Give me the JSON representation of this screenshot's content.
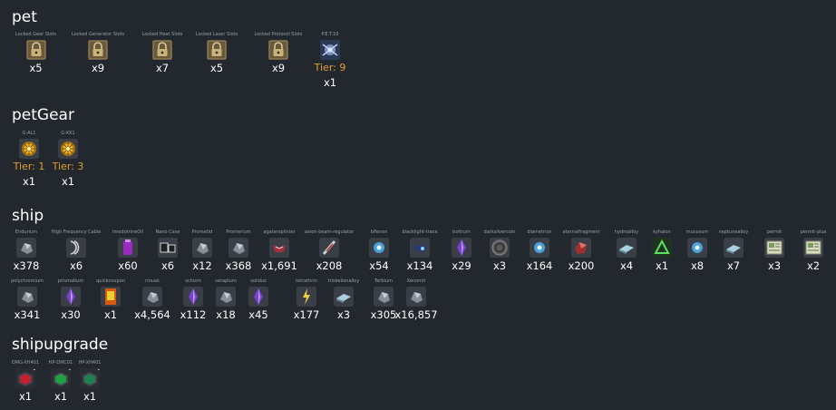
{
  "colors": {
    "background": "#23272e",
    "tier": "#e0a030",
    "label": "#9aa0a8"
  },
  "sections": {
    "pet": {
      "title": "pet",
      "items": [
        {
          "label": "Locked Gear Slots",
          "count": "x5",
          "icon": "lock-icon"
        },
        {
          "label": "Locked Generator Slots",
          "count": "x9",
          "icon": "lock-icon"
        },
        {
          "label": "Locked Heat Slots",
          "count": "x7",
          "icon": "lock-icon"
        },
        {
          "label": "Locked Laser Slots",
          "count": "x5",
          "icon": "lock-icon"
        },
        {
          "label": "Locked Protocol Slots",
          "count": "x9",
          "icon": "lock-icon"
        },
        {
          "label": "P.E.T.10",
          "tier": "Tier: 9",
          "count": "x1",
          "icon": "pet-drone-icon"
        }
      ]
    },
    "petGear": {
      "title": "petGear",
      "items": [
        {
          "label": "G-AL1",
          "tier": "Tier: 1",
          "count": "x1",
          "icon": "gear-orb-icon"
        },
        {
          "label": "G-KK1",
          "tier": "Tier: 3",
          "count": "x1",
          "icon": "gear-orb-icon"
        }
      ]
    },
    "ship": {
      "title": "ship",
      "items": [
        {
          "label": "Endurium",
          "count": "x378",
          "icon": "ore-icon"
        },
        {
          "label": "High Frequency Cable",
          "count": "x6",
          "icon": "cable-icon"
        },
        {
          "label": "ImodotrineOil",
          "count": "x60",
          "icon": "oil-icon"
        },
        {
          "label": "Nano Case",
          "count": "x6",
          "icon": "case-icon"
        },
        {
          "label": "Prometid",
          "count": "x12",
          "icon": "ore-icon"
        },
        {
          "label": "Promerium",
          "count": "x368",
          "icon": "ore-icon"
        },
        {
          "label": "agatarsplinter",
          "count": "x1,691",
          "icon": "splinter-icon"
        },
        {
          "label": "axion-beam-regulator",
          "count": "x208",
          "icon": "regulator-icon"
        },
        {
          "label": "bifenon",
          "count": "x54",
          "icon": "crystal-icon"
        },
        {
          "label": "blacklight-trace",
          "count": "x134",
          "icon": "trace-icon"
        },
        {
          "label": "boltrum",
          "count": "x29",
          "icon": "gem-icon"
        },
        {
          "label": "darksilvercoin",
          "count": "x3",
          "icon": "coin-icon"
        },
        {
          "label": "diametrion",
          "count": "x164",
          "icon": "crystal-icon"
        },
        {
          "label": "eternalfragment",
          "count": "x200",
          "icon": "fragment-icon"
        },
        {
          "label": "hydroalloy",
          "count": "x4",
          "icon": "alloy-icon"
        },
        {
          "label": "kyhalon",
          "count": "x1",
          "icon": "triangle-icon"
        },
        {
          "label": "mucosum",
          "count": "x8",
          "icon": "crystal-icon"
        },
        {
          "label": "neptunealloy",
          "count": "x7",
          "icon": "alloy-icon"
        },
        {
          "label": "permit",
          "count": "x3",
          "icon": "permit-icon"
        },
        {
          "label": "permit-plus",
          "count": "x2",
          "icon": "permit-icon"
        },
        {
          "label": "polychromium",
          "count": "x341",
          "icon": "ore-icon"
        },
        {
          "label": "prismatium",
          "count": "x30",
          "icon": "gem-icon"
        },
        {
          "label": "quickcoupon",
          "count": "x1",
          "icon": "coupon-icon"
        },
        {
          "label": "rinuak",
          "count": "x4,564",
          "icon": "ore-icon"
        },
        {
          "label": "schism",
          "count": "x112",
          "icon": "gem-icon"
        },
        {
          "label": "seraplum",
          "count": "x18",
          "icon": "ore-icon"
        },
        {
          "label": "solidus",
          "count": "x45",
          "icon": "gem-icon"
        },
        {
          "label": "tetrathrin",
          "count": "x177",
          "icon": "spark-icon"
        },
        {
          "label": "triskelionalloy",
          "count": "x3",
          "icon": "alloy-icon"
        },
        {
          "label": "Terbium",
          "count": "x305",
          "icon": "ore-icon"
        },
        {
          "label": "Xenomit",
          "count": "x16,857",
          "icon": "ore-icon"
        }
      ]
    },
    "shipupgrade": {
      "title": "shipupgrade",
      "items": [
        {
          "label": "DMG-XH401",
          "count": "x1",
          "badge": "1",
          "icon": "upgrade-icon"
        },
        {
          "label": "HP-DMC01",
          "count": "x1",
          "badge": "1",
          "icon": "upgrade-icon"
        },
        {
          "label": "HP-XH401",
          "count": "x1",
          "badge": "1",
          "icon": "upgrade-icon"
        }
      ]
    }
  }
}
